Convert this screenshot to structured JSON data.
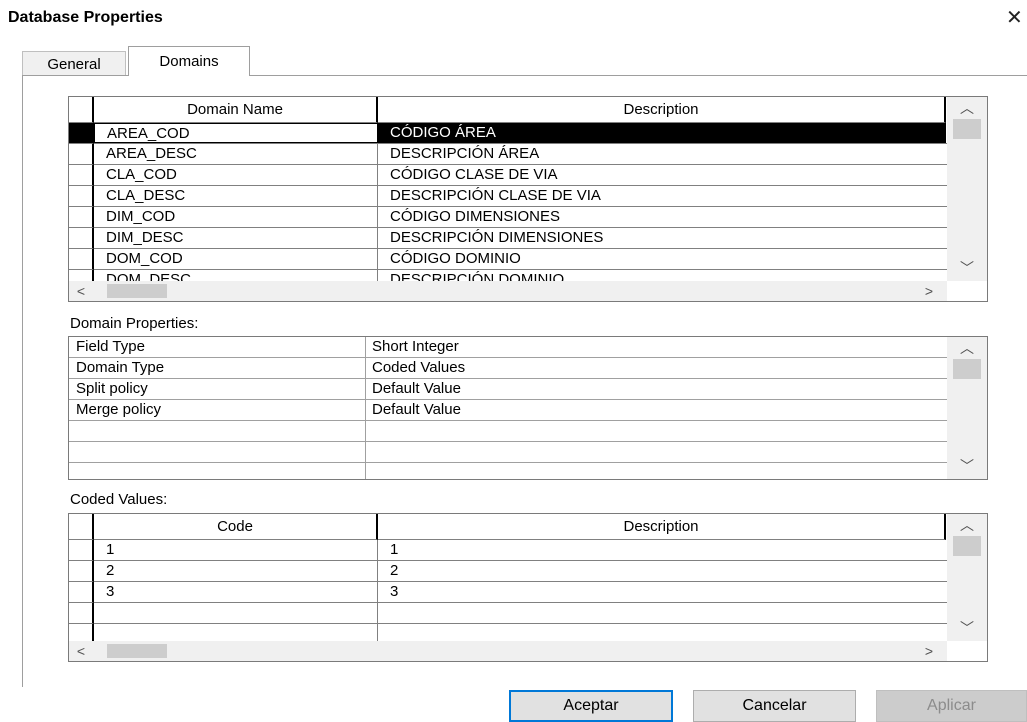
{
  "window": {
    "title": "Database Properties",
    "close_glyph": "✕"
  },
  "tabs": [
    {
      "label": "General"
    },
    {
      "label": "Domains"
    }
  ],
  "domains_table": {
    "headers": {
      "name": "Domain Name",
      "description": "Description"
    },
    "rows": [
      {
        "name": "AREA_COD",
        "description": "CÓDIGO ÁREA"
      },
      {
        "name": "AREA_DESC",
        "description": "DESCRIPCIÓN ÁREA"
      },
      {
        "name": "CLA_COD",
        "description": "CÓDIGO CLASE DE VIA"
      },
      {
        "name": "CLA_DESC",
        "description": "DESCRIPCIÓN CLASE DE VIA"
      },
      {
        "name": "DIM_COD",
        "description": "CÓDIGO DIMENSIONES"
      },
      {
        "name": "DIM_DESC",
        "description": "DESCRIPCIÓN DIMENSIONES"
      },
      {
        "name": "DOM_COD",
        "description": "CÓDIGO DOMINIO"
      },
      {
        "name": "DOM_DESC",
        "description": "DESCRIPCIÓN DOMINIO"
      }
    ],
    "selected_row": 0
  },
  "domain_properties": {
    "label": "Domain Properties:",
    "rows": [
      {
        "key": "Field Type",
        "value": "Short Integer"
      },
      {
        "key": "Domain Type",
        "value": "Coded Values"
      },
      {
        "key": "Split policy",
        "value": "Default Value"
      },
      {
        "key": "Merge policy",
        "value": "Default Value"
      }
    ]
  },
  "coded_values": {
    "label": "Coded Values:",
    "headers": {
      "code": "Code",
      "description": "Description"
    },
    "rows": [
      {
        "code": "1",
        "description": "1"
      },
      {
        "code": "2",
        "description": "2"
      },
      {
        "code": "3",
        "description": "3"
      }
    ]
  },
  "buttons": {
    "ok": "Aceptar",
    "cancel": "Cancelar",
    "apply": "Aplicar"
  },
  "icons": {
    "scroll_up": "chevron-up-icon",
    "scroll_down": "chevron-down-icon",
    "scroll_left": "chevron-left-icon",
    "scroll_right": "chevron-right-icon"
  },
  "colors": {
    "focus_border": "#0078d7",
    "selection": "#000000"
  }
}
